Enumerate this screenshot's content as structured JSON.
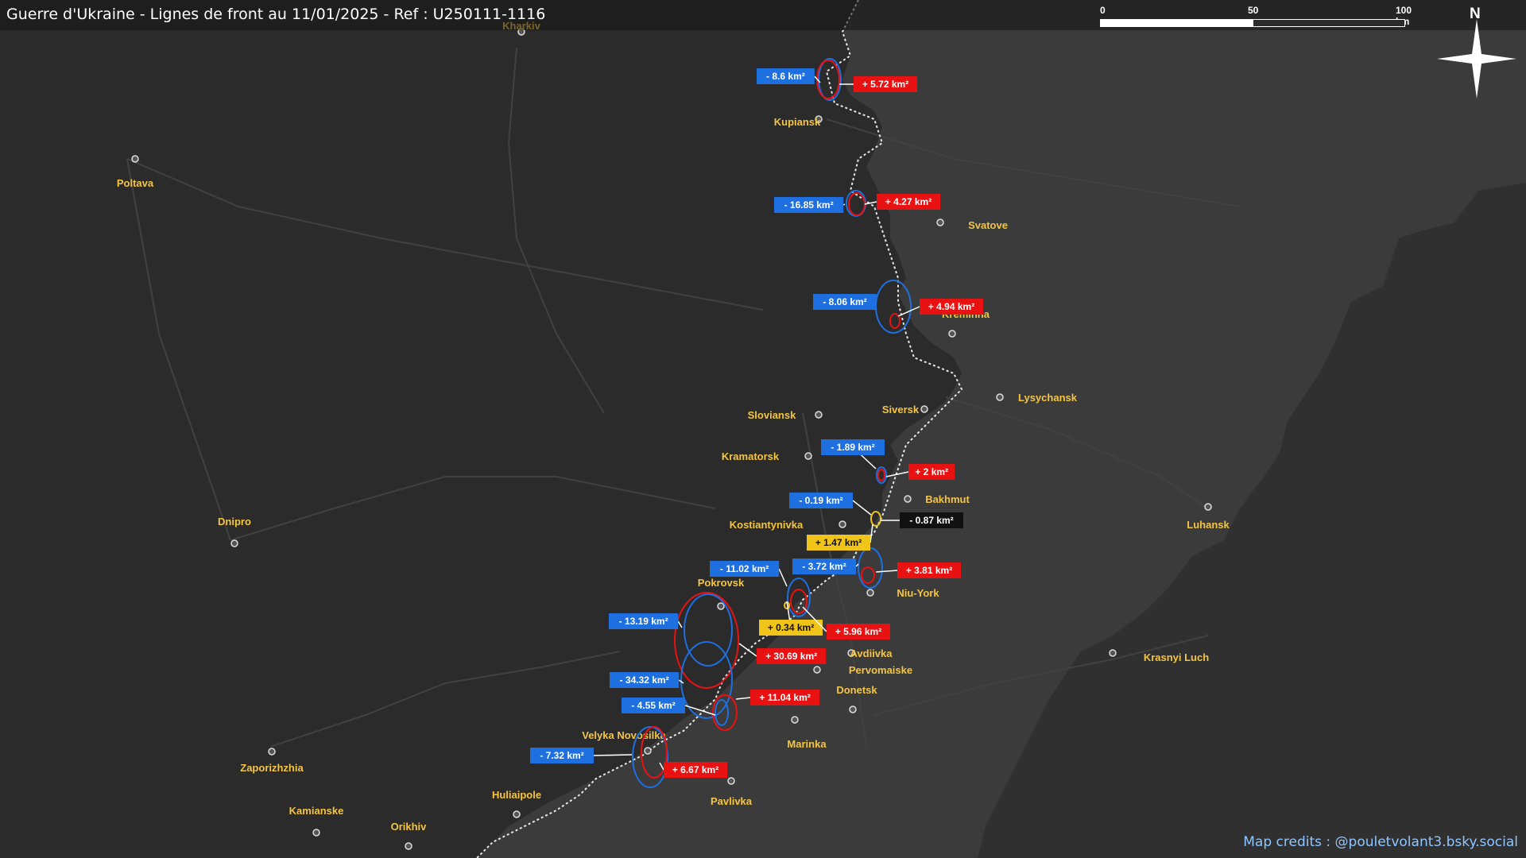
{
  "map": {
    "title": "Guerre d'Ukraine - Lignes de front au 11/01/2025 - Ref : U250111-1116",
    "credits": "Map credits : @pouletvolant3.bsky.social",
    "scale": {
      "ticks": [
        "0",
        "50",
        "100 km"
      ]
    },
    "north_label": "N",
    "colors": {
      "background": "#2b2b2b",
      "occupied_area": "#3b3b3b",
      "front_line": "#e8e8e8",
      "loss": "#1e6fe0",
      "gain": "#e81212",
      "neutral_change": "#f0c419",
      "city_label": "#f5c542",
      "annotation_white": "#ffffff",
      "annotation_black": "#111111"
    },
    "cities": [
      {
        "name": "Kharkiv"
      },
      {
        "name": "Poltava"
      },
      {
        "name": "Kupiansk"
      },
      {
        "name": "Svatove"
      },
      {
        "name": "Kreminna"
      },
      {
        "name": "Lysychansk"
      },
      {
        "name": "Siversk"
      },
      {
        "name": "Sloviansk"
      },
      {
        "name": "Kramatorsk"
      },
      {
        "name": "Bakhmut"
      },
      {
        "name": "Kostiantynivka"
      },
      {
        "name": "Dnipro"
      },
      {
        "name": "Luhansk"
      },
      {
        "name": "Pokrovsk"
      },
      {
        "name": "Niu-York"
      },
      {
        "name": "Avdiivka"
      },
      {
        "name": "Pervomaiske"
      },
      {
        "name": "Donetsk"
      },
      {
        "name": "Krasnyi Luch"
      },
      {
        "name": "Marinka"
      },
      {
        "name": "Velyka Novosilka"
      },
      {
        "name": "Zaporizhzhia"
      },
      {
        "name": "Huliaipole"
      },
      {
        "name": "Pavlivka"
      },
      {
        "name": "Kamianske"
      },
      {
        "name": "Orikhiv"
      }
    ],
    "changes": [
      {
        "label": "- 8.6 km²",
        "kind": "loss"
      },
      {
        "label": "+ 5.72 km²",
        "kind": "gain"
      },
      {
        "label": "- 16.85 km²",
        "kind": "loss"
      },
      {
        "label": "+ 4.27 km²",
        "kind": "gain"
      },
      {
        "label": "- 8.06 km²",
        "kind": "loss"
      },
      {
        "label": "+ 4.94 km²",
        "kind": "gain"
      },
      {
        "label": "- 1.89 km²",
        "kind": "loss"
      },
      {
        "label": "+ 2 km²",
        "kind": "gain"
      },
      {
        "label": "- 0.19 km²",
        "kind": "loss"
      },
      {
        "label": "- 0.87 km²",
        "kind": "net"
      },
      {
        "label": "+ 1.47 km²",
        "kind": "neutral"
      },
      {
        "label": "- 11.02 km²",
        "kind": "loss"
      },
      {
        "label": "- 3.72 km²",
        "kind": "loss"
      },
      {
        "label": "+ 3.81 km²",
        "kind": "gain"
      },
      {
        "label": "+ 0.34 km²",
        "kind": "neutral"
      },
      {
        "label": "+ 5.96 km²",
        "kind": "gain"
      },
      {
        "label": "- 13.19 km²",
        "kind": "loss"
      },
      {
        "label": "+ 30.69 km²",
        "kind": "gain"
      },
      {
        "label": "- 34.32 km²",
        "kind": "loss"
      },
      {
        "label": "+ 11.04 km²",
        "kind": "gain"
      },
      {
        "label": "- 4.55 km²",
        "kind": "loss"
      },
      {
        "label": "- 7.32 km²",
        "kind": "loss"
      },
      {
        "label": "+ 6.67 km²",
        "kind": "gain"
      }
    ]
  }
}
